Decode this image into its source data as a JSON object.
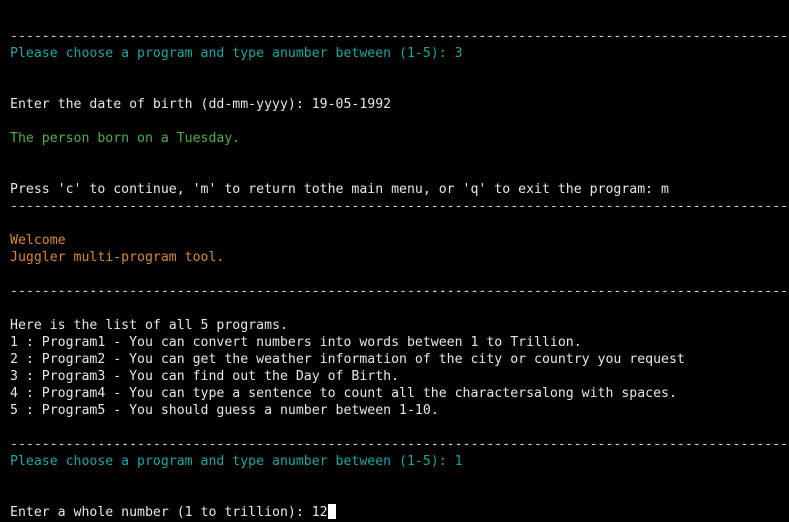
{
  "separator": "----------------------------------------------------------------------------------------------------",
  "prompt_choose_1": "Please choose a program and type anumber between (1-5): 3",
  "dob_prompt": "Enter the date of birth (dd-mm-yyyy): 19-05-1992",
  "dob_result": "The person born on a Tuesday.",
  "continue_prompt": "Press 'c' to continue, 'm' to return tothe main menu, or 'q' to exit the program: m",
  "welcome": "Welcome",
  "tool_name": "Juggler multi-program tool.",
  "list_header": "Here is the list of all 5 programs.",
  "programs": [
    "1 : Program1 - You can convert numbers into words between 1 to Trillion.",
    "2 : Program2 - You can get the weather information of the city or country you request",
    "3 : Program3 - You can find out the Day of Birth.",
    "4 : Program4 - You can type a sentence to count all the charactersalong with spaces.",
    "5 : Program5 - You should guess a number between 1-10."
  ],
  "prompt_choose_2": "Please choose a program and type anumber between (1-5): 1",
  "number_prompt": "Enter a whole number (1 to trillion): 12",
  "colors": {
    "background": "#000000",
    "prompt": "#1aa6a6",
    "result": "#4caf50",
    "welcome": "#d7892e",
    "text": "#e6e6e6"
  }
}
